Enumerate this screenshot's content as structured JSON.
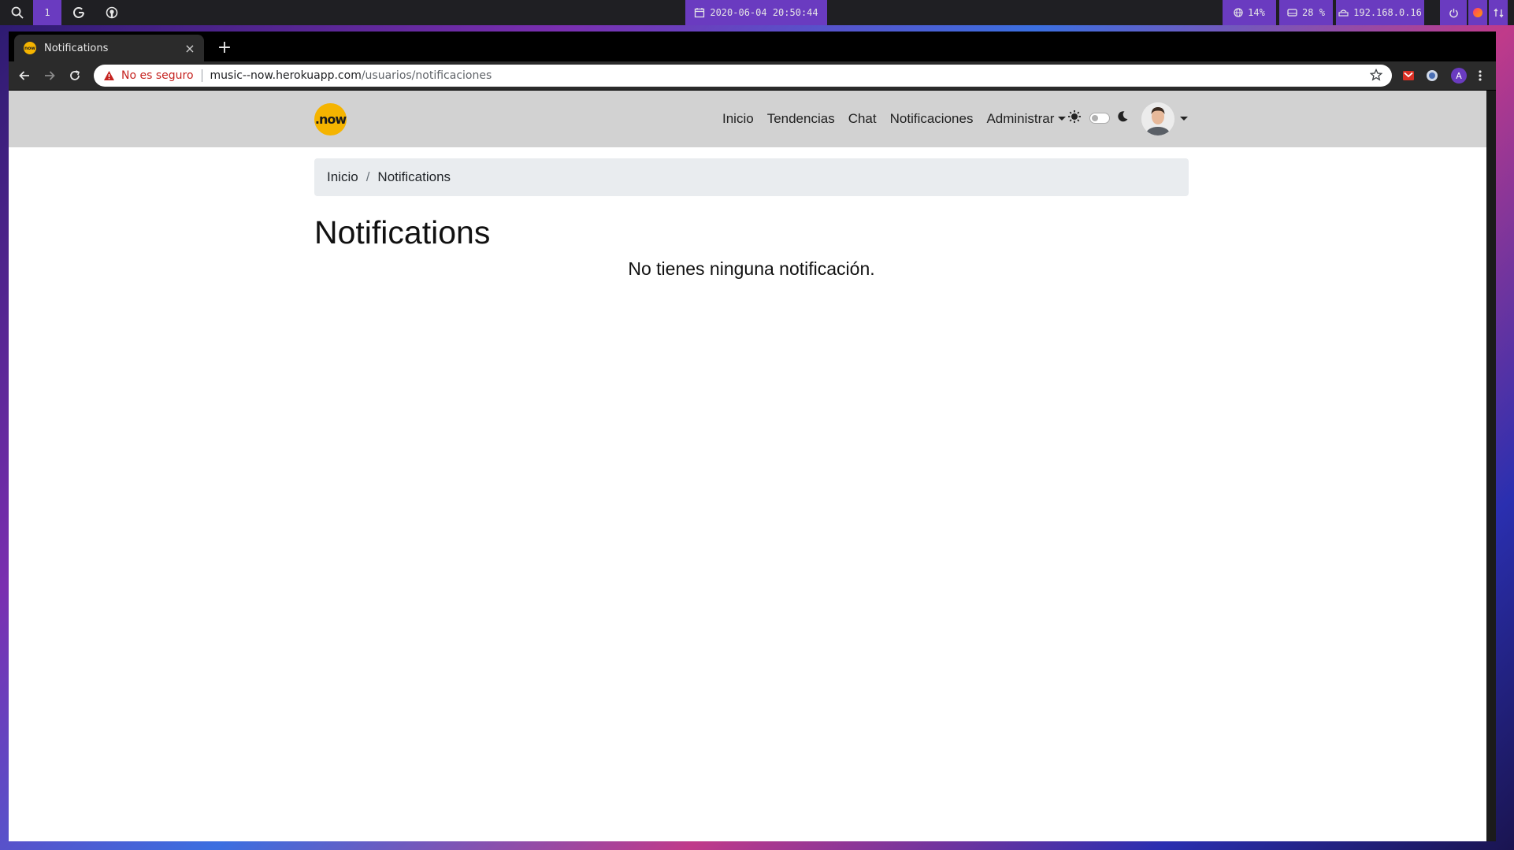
{
  "os_bar": {
    "workspace": "1",
    "datetime": "2020-06-04 20:50:44",
    "cpu": "14%",
    "disk": "28 %",
    "ip": "192.168.0.16"
  },
  "browser": {
    "tab_title": "Notifications",
    "new_tab": "+",
    "security_label": "No es seguro",
    "url_host": "music--now.herokuapp.com",
    "url_path": "/usuarios/notificaciones",
    "profile_initial": "A"
  },
  "site": {
    "logo_text": ".now",
    "nav": [
      "Inicio",
      "Tendencias",
      "Chat",
      "Notificaciones",
      "Administrar"
    ],
    "breadcrumb": [
      "Inicio",
      "Notifications"
    ],
    "breadcrumb_sep": "/",
    "title": "Notifications",
    "empty_message": "No tienes ninguna notificación."
  },
  "colors": {
    "os_bar": "#1f1f23",
    "os_accent": "#6a3bc0",
    "navbar": "#d2d2d2",
    "logo": "#f5b400",
    "breadcrumb_bg": "#e9ecef",
    "insecure": "#c5221f"
  }
}
